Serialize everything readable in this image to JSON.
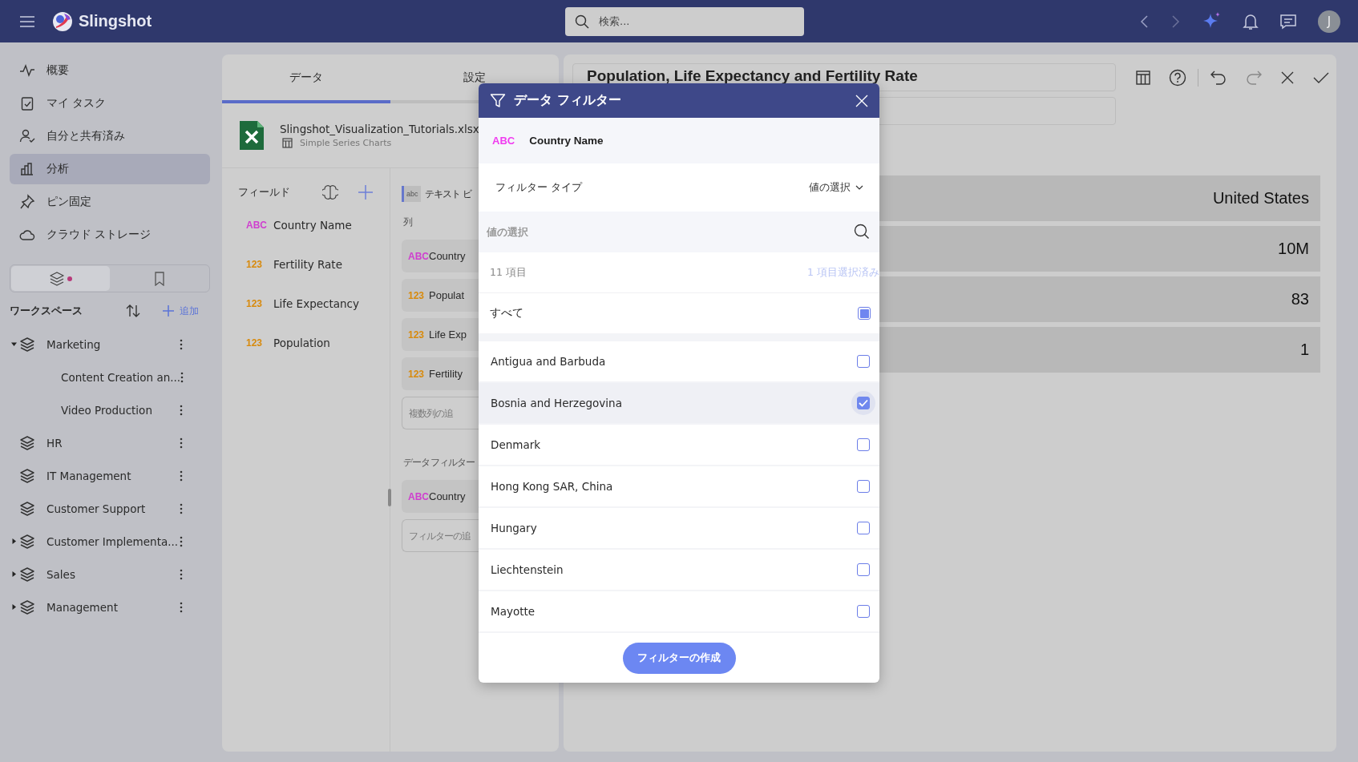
{
  "topbar": {
    "app_name": "Slingshot",
    "search": {
      "placeholder": "検索..."
    },
    "avatar": "J"
  },
  "nav": [
    {
      "label": "概要",
      "selected": false
    },
    {
      "label": "マイ タスク",
      "selected": false
    },
    {
      "label": "自分と共有済み",
      "selected": false
    },
    {
      "label": "分析",
      "selected": true
    },
    {
      "label": "ピン固定",
      "selected": false
    },
    {
      "label": "クラウド ストレージ",
      "selected": false
    }
  ],
  "sidebar_tabs": [
    {
      "selected": true,
      "dot": true
    },
    {
      "selected": false,
      "dot": false
    }
  ],
  "workspaces": {
    "title": "ワークスペース",
    "add": "追加",
    "items": [
      {
        "label": "Marketing",
        "kind": "group",
        "expanded": true,
        "children": [
          {
            "label": "Content Creation an..."
          },
          {
            "label": "Video Production"
          }
        ]
      },
      {
        "label": "HR",
        "kind": "workspace"
      },
      {
        "label": "IT Management",
        "kind": "workspace"
      },
      {
        "label": "Customer Support",
        "kind": "workspace"
      },
      {
        "label": "Customer Implementa...",
        "kind": "group",
        "expanded": false
      },
      {
        "label": "Sales",
        "kind": "group",
        "expanded": false
      },
      {
        "label": "Management",
        "kind": "group",
        "expanded": false
      }
    ]
  },
  "editor": {
    "tabs": [
      {
        "label": "データ",
        "selected": true
      },
      {
        "label": "設定",
        "selected": false
      }
    ],
    "source": {
      "file": "Slingshot_Visualization_Tutorials.xlsx",
      "sheet": "Simple Series Charts"
    },
    "fields": {
      "title": "フィールド",
      "items": [
        {
          "kind": "text",
          "type": "ABC",
          "name": "Country Name"
        },
        {
          "kind": "number",
          "type": "123",
          "name": "Fertility Rate"
        },
        {
          "kind": "number",
          "type": "123",
          "name": "Life Expectancy"
        },
        {
          "kind": "number",
          "type": "123",
          "name": "Population"
        }
      ]
    },
    "visualization": {
      "badge": "abc",
      "name": "テキスト ビ",
      "columns_label": "列",
      "columns": [
        {
          "kind": "text",
          "type": "ABC",
          "name": "Country"
        },
        {
          "kind": "number",
          "type": "123",
          "name": "Populat"
        },
        {
          "kind": "number",
          "type": "123",
          "name": "Life Exp"
        },
        {
          "kind": "number",
          "type": "123",
          "name": "Fertility"
        }
      ],
      "add_columns": {
        "placeholder": "複数列の追"
      },
      "filters_label": "データ フィルター",
      "filters": [
        {
          "kind": "text",
          "type": "ABC",
          "name": "Country"
        }
      ],
      "add_filter": {
        "placeholder": "フィルターの追"
      }
    }
  },
  "dashboard": {
    "title": "Population, Life Expectancy and Fertility Rate",
    "values": [
      "United States",
      "10M",
      "83",
      "1"
    ]
  },
  "dialog": {
    "title": "データ フィルター",
    "field": {
      "kind": "text",
      "type": "ABC",
      "name": "Country Name"
    },
    "filter_type": {
      "label": "フィルター タイプ",
      "value": "値の選択"
    },
    "search": {
      "placeholder": "値の選択"
    },
    "count": "11 項目",
    "selected_count": "1 項目選択済み",
    "all": {
      "label": "すべて",
      "checked": false,
      "indeterminate": true
    },
    "items": [
      {
        "label": "Antigua and Barbuda",
        "checked": false,
        "hovered": false
      },
      {
        "label": "Bosnia and Herzegovina",
        "checked": true,
        "hovered": true
      },
      {
        "label": "Denmark",
        "checked": false,
        "hovered": false
      },
      {
        "label": "Hong Kong SAR, China",
        "checked": false,
        "hovered": false
      },
      {
        "label": "Hungary",
        "checked": false,
        "hovered": false
      },
      {
        "label": "Liechtenstein",
        "checked": false,
        "hovered": false
      },
      {
        "label": "Mayotte",
        "checked": false,
        "hovered": false
      }
    ],
    "button": "フィルターの作成"
  }
}
